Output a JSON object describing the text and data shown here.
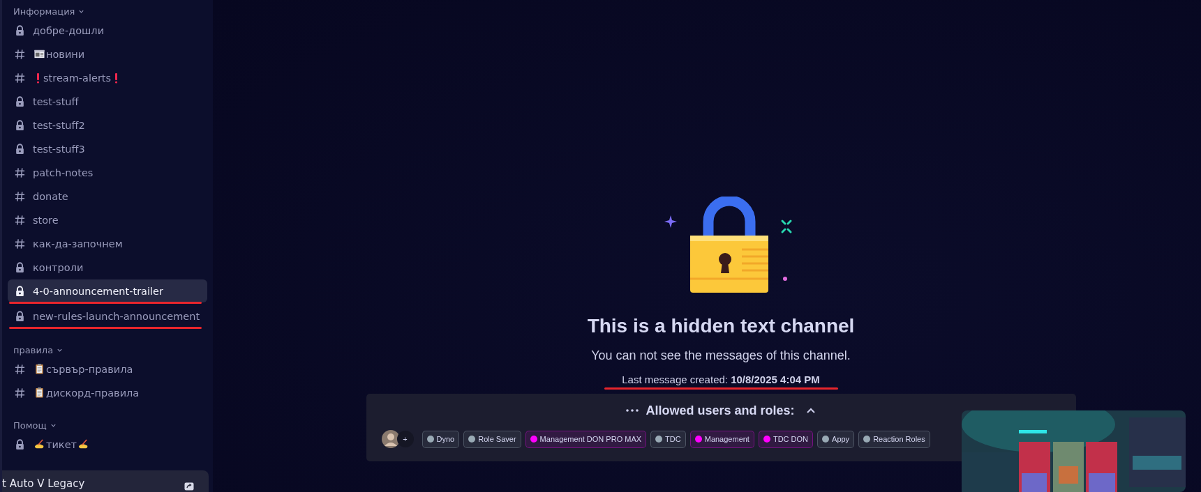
{
  "sidebar": {
    "sections": [
      {
        "title": "Информация",
        "items": [
          {
            "kind": "lock",
            "label": "добре-дошли",
            "selected": false,
            "underlined": false
          },
          {
            "kind": "hash",
            "decor_before": {
              "kind": "news"
            },
            "label": "новини",
            "selected": false,
            "underlined": false
          },
          {
            "kind": "hash",
            "decor_before": {
              "kind": "alert"
            },
            "decor_after": {
              "kind": "alert"
            },
            "label": "stream-alerts",
            "selected": false,
            "underlined": false
          },
          {
            "kind": "lock",
            "label": "test-stuff",
            "selected": false,
            "underlined": false
          },
          {
            "kind": "lock",
            "label": "test-stuff2",
            "selected": false,
            "underlined": false
          },
          {
            "kind": "lock",
            "label": "test-stuff3",
            "selected": false,
            "underlined": false
          },
          {
            "kind": "hash",
            "label": "patch-notes",
            "selected": false,
            "underlined": false
          },
          {
            "kind": "hash",
            "label": "donate",
            "selected": false,
            "underlined": false
          },
          {
            "kind": "hash",
            "label": "store",
            "selected": false,
            "underlined": false
          },
          {
            "kind": "hash",
            "label": "как-да-започнем",
            "selected": false,
            "underlined": false
          },
          {
            "kind": "lock",
            "label": "контроли",
            "selected": false,
            "underlined": false
          },
          {
            "kind": "lock",
            "label": "4-0-announcement-trailer",
            "selected": true,
            "underlined": true
          },
          {
            "kind": "lock",
            "label": "new-rules-launch-announcement",
            "selected": false,
            "underlined": true
          }
        ]
      },
      {
        "title": "правила",
        "items": [
          {
            "kind": "hash",
            "decor_before": {
              "kind": "clipboard"
            },
            "label": "сървър-правила",
            "selected": false,
            "underlined": false
          },
          {
            "kind": "hash",
            "decor_before": {
              "kind": "clipboard"
            },
            "label": "дискорд-правила",
            "selected": false,
            "underlined": false
          }
        ]
      },
      {
        "title": "Помощ",
        "items": [
          {
            "kind": "lock",
            "decor_before": {
              "kind": "writing"
            },
            "decor_after": {
              "kind": "writing"
            },
            "label": "тикет",
            "selected": false,
            "underlined": false
          }
        ]
      }
    ],
    "activity": {
      "label": "t Auto V Legacy"
    }
  },
  "main": {
    "title": "This is a hidden text channel",
    "subtitle": "You can not see the messages of this channel.",
    "last_message": {
      "text": "Last message created: **10/8/2025 4:04 PM**",
      "underlined": true
    },
    "allowed": {
      "title": "Allowed users and roles:",
      "expanded": true,
      "more": "+",
      "roles": [
        {
          "name": "Dyno",
          "color": "#99aab5"
        },
        {
          "name": "Role Saver",
          "color": "#99aab5"
        },
        {
          "name": "Management DON PRO MAX",
          "color": "#ff00ff"
        },
        {
          "name": "TDC",
          "color": "#99aab5"
        },
        {
          "name": "Management",
          "color": "#ff00ff"
        },
        {
          "name": "TDC DON",
          "color": "#ff00ff"
        },
        {
          "name": "Appy",
          "color": "#99aab5"
        },
        {
          "name": "Reaction Roles",
          "color": "#99aab5"
        }
      ]
    }
  }
}
